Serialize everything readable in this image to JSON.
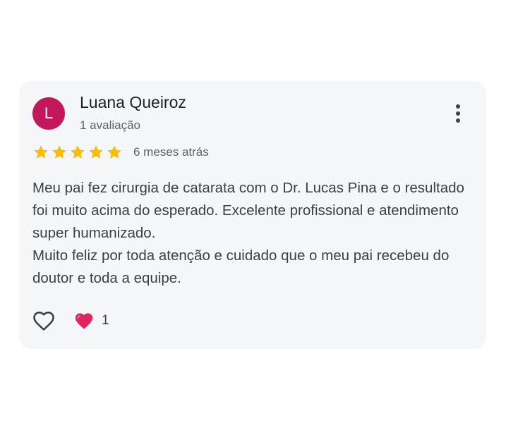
{
  "review": {
    "avatar_letter": "L",
    "avatar_color": "#c2185b",
    "author_name": "Luana Queiroz",
    "author_review_count": "1 avaliação",
    "rating": 5,
    "rating_max": 5,
    "star_color": "#fbbc04",
    "date": "6 meses atrás",
    "paragraphs": [
      "Meu pai fez cirurgia de catarata com o Dr. Lucas Pina e o resultado foi muito acima do esperado. Excelente profissional e atendimento super humanizado.",
      "Muito feliz por toda atenção e cuidado que o meu pai recebeu do doutor e toda a equipe."
    ]
  },
  "actions": {
    "like_icon": "heart-outline-icon",
    "reaction_icon": "red-heart-icon",
    "reaction_color": "#e0245e",
    "reaction_count": "1",
    "menu_icon": "more-vertical-icon"
  }
}
